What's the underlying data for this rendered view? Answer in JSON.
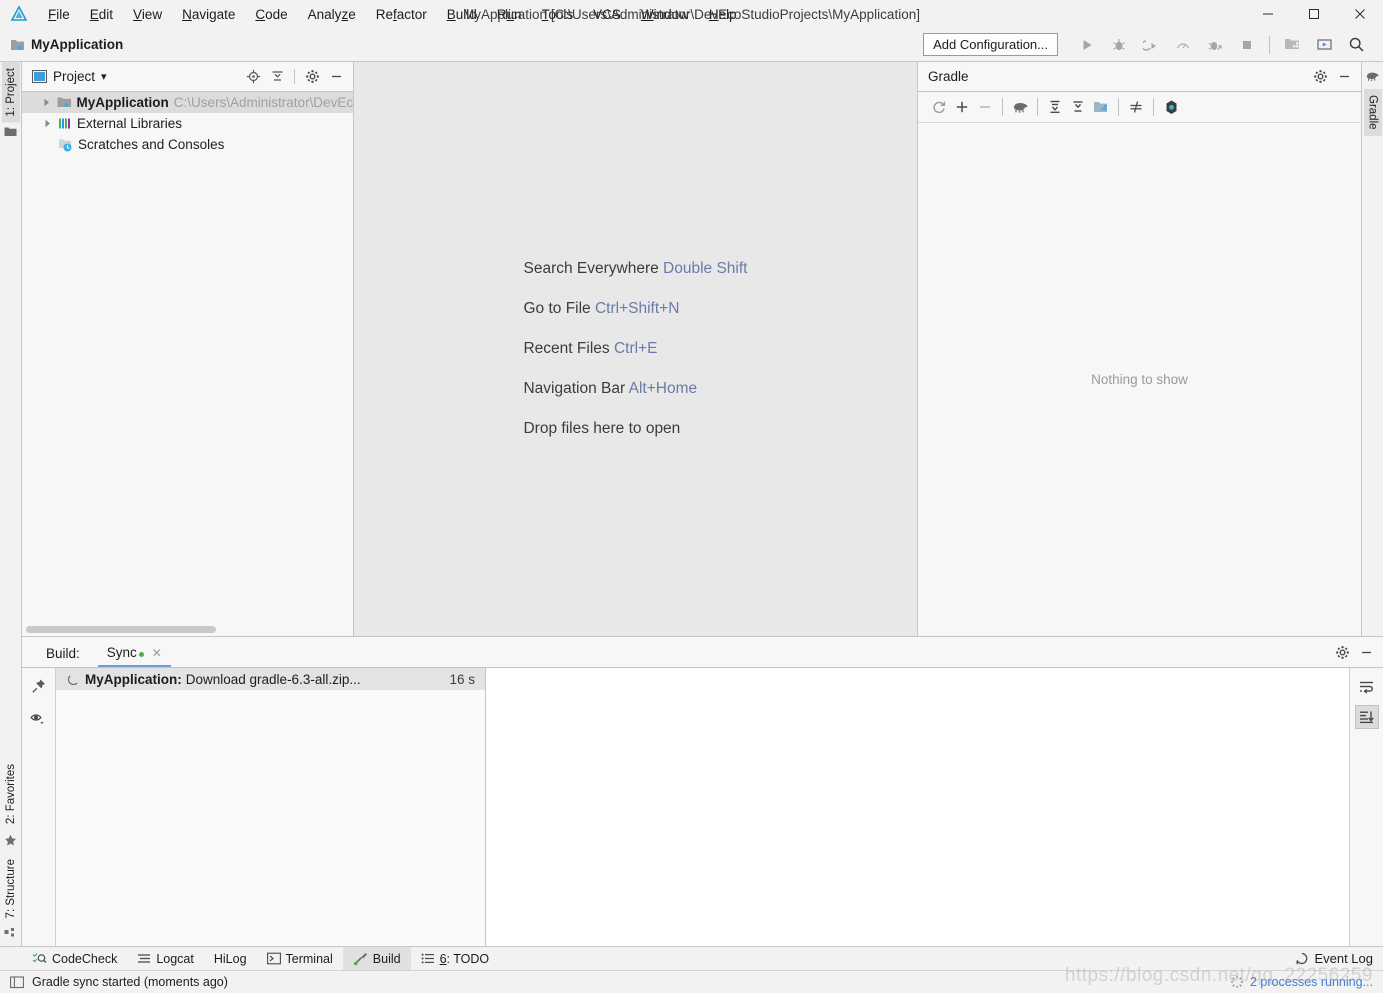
{
  "window": {
    "title": "MyApplication [C:\\Users\\Administrator\\DevEcoStudioProjects\\MyApplication]",
    "minimize": "—",
    "maximize": "□",
    "close": "✕"
  },
  "menu": {
    "items": [
      {
        "label": "File",
        "mnemonic": "F"
      },
      {
        "label": "Edit",
        "mnemonic": "E"
      },
      {
        "label": "View",
        "mnemonic": "V"
      },
      {
        "label": "Navigate",
        "mnemonic": "N"
      },
      {
        "label": "Code",
        "mnemonic": "C"
      },
      {
        "label": "Analyze",
        "mnemonic": "z"
      },
      {
        "label": "Refactor",
        "mnemonic": "R"
      },
      {
        "label": "Build",
        "mnemonic": "B"
      },
      {
        "label": "Run",
        "mnemonic": "R"
      },
      {
        "label": "Tools",
        "mnemonic": "T"
      },
      {
        "label": "VCS",
        "mnemonic": "V"
      },
      {
        "label": "Window",
        "mnemonic": "W"
      },
      {
        "label": "Help",
        "mnemonic": "H"
      }
    ]
  },
  "navbar": {
    "breadcrumb": "MyApplication",
    "add_configuration": "Add Configuration...",
    "icons": [
      "run-icon",
      "debug-icon",
      "attach-debugger-icon",
      "profiler-icon",
      "debug-attach-icon",
      "stop-icon",
      "sep",
      "project-structure-icon",
      "device-manager-icon",
      "search-icon"
    ]
  },
  "left_strip": {
    "tabs_top": [
      {
        "label": "1: Project",
        "active": true,
        "icon": "project-icon"
      }
    ],
    "tabs_bottom": [
      {
        "label": "2: Favorites",
        "icon": "star-icon"
      },
      {
        "label": "7: Structure",
        "icon": "structure-icon"
      }
    ]
  },
  "right_strip": {
    "tabs": [
      {
        "label": "Gradle",
        "icon": "gradle-elephant-icon"
      }
    ]
  },
  "project_panel": {
    "title": "Project",
    "dropdown": "▾",
    "actions": [
      "locate-icon",
      "collapse-all-icon",
      "settings-icon",
      "hide-icon"
    ],
    "tree": [
      {
        "label": "MyApplication",
        "path": "C:\\Users\\Administrator\\DevEcoStu",
        "icon": "module-icon",
        "expandable": true,
        "selected": true,
        "indent": 0
      },
      {
        "label": "External Libraries",
        "path": "",
        "icon": "libraries-icon",
        "expandable": true,
        "selected": false,
        "indent": 0
      },
      {
        "label": "Scratches and Consoles",
        "path": "",
        "icon": "scratches-icon",
        "expandable": false,
        "selected": false,
        "indent": 0
      }
    ]
  },
  "editor": {
    "hints": [
      {
        "text": "Search Everywhere ",
        "key": "Double Shift"
      },
      {
        "text": "Go to File ",
        "key": "Ctrl+Shift+N"
      },
      {
        "text": "Recent Files ",
        "key": "Ctrl+E"
      },
      {
        "text": "Navigation Bar ",
        "key": "Alt+Home"
      },
      {
        "text": "Drop files here to open",
        "key": ""
      }
    ]
  },
  "gradle_panel": {
    "title": "Gradle",
    "actions": [
      "settings-icon",
      "hide-icon"
    ],
    "toolbar": [
      "refresh-icon",
      "add-icon",
      "remove-icon",
      "sep",
      "gradle-elephant-icon",
      "sep",
      "expand-all-icon",
      "collapse-all-icon",
      "project-structure-icon",
      "sep",
      "toggle-offline-icon",
      "sep",
      "execute-task-icon"
    ],
    "empty_text": "Nothing to show"
  },
  "build_panel": {
    "label": "Build:",
    "tab": "Sync",
    "tab_close": "✕",
    "actions": [
      "settings-icon",
      "hide-icon"
    ],
    "gutter_icons": [
      "pin-icon",
      "eye-icon"
    ],
    "right_icons": [
      "soft-wrap-icon",
      "scroll-to-end-icon"
    ],
    "tree": [
      {
        "prefix": "MyApplication:",
        "text": " Download gradle-6.3-all.zip...",
        "time": "16 s",
        "status": "running"
      }
    ]
  },
  "tool_window_bar": {
    "items": [
      {
        "label": "CodeCheck",
        "icon": "codecheck-icon",
        "active": false
      },
      {
        "label": "Logcat",
        "icon": "logcat-icon",
        "active": false
      },
      {
        "label": "HiLog",
        "icon": "",
        "active": false
      },
      {
        "label": "Terminal",
        "icon": "terminal-icon",
        "active": false
      },
      {
        "label": "Build",
        "icon": "build-hammer-icon",
        "active": true
      },
      {
        "label": "6: TODO",
        "icon": "todo-icon",
        "active": false,
        "mnemonic": "6"
      }
    ],
    "event_log": "Event Log",
    "event_log_icon": "event-log-icon"
  },
  "statusbar": {
    "icon": "status-layout-icon",
    "message": "Gradle sync started (moments ago)",
    "processes": "2 processes running...",
    "processes_icon": "spinner-icon",
    "watermark": "https://blog.csdn.net/qq_22256259"
  },
  "colors": {
    "accent_blue": "#6e9ed4",
    "link_blue": "#3b7dd8",
    "hint_key": "#6b7ba8",
    "green_status": "#4caf50",
    "panel_bg": "#f7f7f7",
    "editor_bg": "#e8e8e8",
    "chrome_bg": "#f2f2f2"
  }
}
